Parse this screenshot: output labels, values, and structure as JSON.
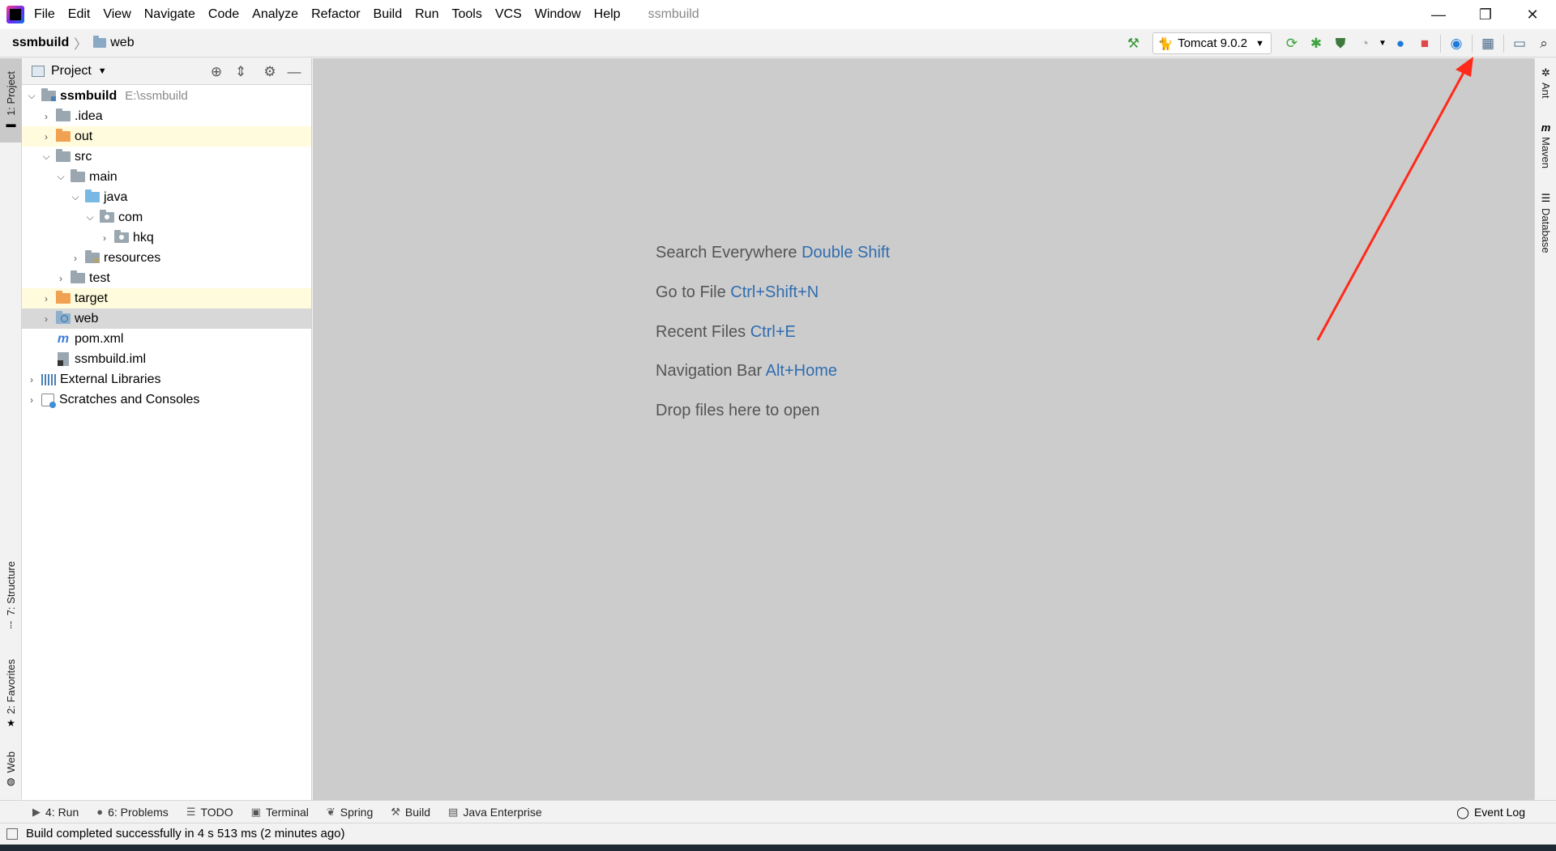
{
  "title_bar": {
    "menu": [
      "File",
      "Edit",
      "View",
      "Navigate",
      "Code",
      "Analyze",
      "Refactor",
      "Build",
      "Run",
      "Tools",
      "VCS",
      "Window",
      "Help"
    ],
    "project_name": "ssmbuild",
    "minimize": "—",
    "restore": "❐",
    "close": "✕"
  },
  "breadcrumb": {
    "root": "ssmbuild",
    "current": "web"
  },
  "toolbar": {
    "run_config": "Tomcat 9.0.2"
  },
  "left_strip": {
    "project_tab": "1: Project",
    "structure_tab": "7: Structure",
    "favorites_tab": "2: Favorites",
    "web_tab": "Web"
  },
  "right_strip": {
    "ant_tab": "Ant",
    "maven_tab": "Maven",
    "database_tab": "Database"
  },
  "project_panel": {
    "title": "Project",
    "tree": [
      {
        "label": "ssmbuild",
        "path": "E:\\ssmbuild"
      },
      {
        "label": ".idea"
      },
      {
        "label": "out"
      },
      {
        "label": "src"
      },
      {
        "label": "main"
      },
      {
        "label": "java"
      },
      {
        "label": "com"
      },
      {
        "label": "hkq"
      },
      {
        "label": "resources"
      },
      {
        "label": "test"
      },
      {
        "label": "target"
      },
      {
        "label": "web"
      },
      {
        "label": "pom.xml"
      },
      {
        "label": "ssmbuild.iml"
      },
      {
        "label": "External Libraries"
      },
      {
        "label": "Scratches and Consoles"
      }
    ]
  },
  "welcome": {
    "tips": [
      {
        "text": "Search Everywhere",
        "shortcut": "Double Shift"
      },
      {
        "text": "Go to File",
        "shortcut": "Ctrl+Shift+N"
      },
      {
        "text": "Recent Files",
        "shortcut": "Ctrl+E"
      },
      {
        "text": "Navigation Bar",
        "shortcut": "Alt+Home"
      },
      {
        "text": "Drop files here to open",
        "shortcut": ""
      }
    ]
  },
  "bottom_tools": {
    "run": "4: Run",
    "problems": "6: Problems",
    "todo": "TODO",
    "terminal": "Terminal",
    "spring": "Spring",
    "build": "Build",
    "java_enterprise": "Java Enterprise",
    "event_log": "Event Log"
  },
  "status": {
    "message": "Build completed successfully in 4 s 513 ms (2 minutes ago)"
  },
  "colors": {
    "accent": "#2f6db0",
    "annotation": "#ff2a1a",
    "editor_bg": "#cccccc"
  }
}
